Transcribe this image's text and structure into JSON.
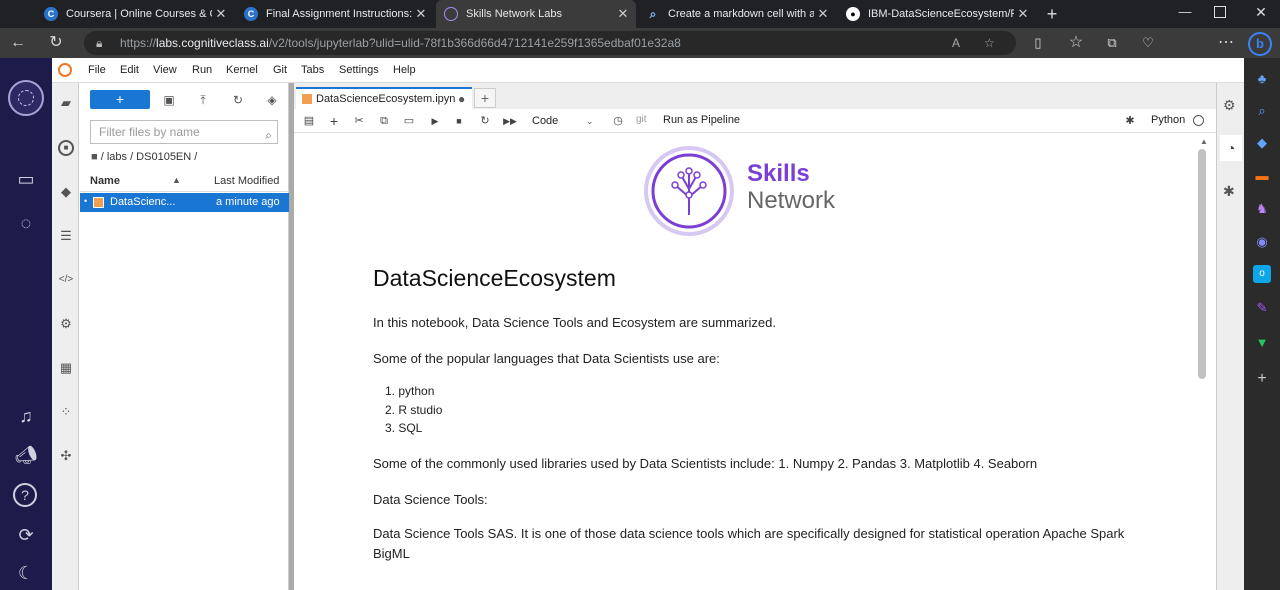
{
  "browser": {
    "tabs": [
      {
        "title": "Coursera | Online Courses & Cre",
        "favicon": "coursera-icon"
      },
      {
        "title": "Final Assignment Instructions: Cr",
        "favicon": "coursera-icon"
      },
      {
        "title": "Skills Network Labs",
        "favicon": "skills-network-icon",
        "active": true
      },
      {
        "title": "Create a markdown cell with a ta",
        "favicon": "search-icon"
      },
      {
        "title": "IBM-DataScienceEcosystem/Peer",
        "favicon": "github-icon"
      }
    ],
    "url_prefix": "https://",
    "url_host": "labs.cognitiveclass.ai",
    "url_rest": "/v2/tools/jupyterlab?ulid=ulid-78f1b366d66d4712141e259f1365edbaf01e32a8"
  },
  "menubar": [
    "File",
    "Edit",
    "View",
    "Run",
    "Kernel",
    "Git",
    "Tabs",
    "Settings",
    "Help"
  ],
  "filebrowser": {
    "new_label": "+",
    "filter_placeholder": "Filter files by name",
    "breadcrumb": "/ labs / DS0105EN /",
    "col_name": "Name",
    "col_modified": "Last Modified",
    "files": [
      {
        "name": "DataScienc...",
        "modified": "a minute ago"
      }
    ]
  },
  "notebook": {
    "tab_title": "DataScienceEcosystem.ipyn",
    "cell_type": "Code",
    "git_label": "git",
    "pipeline_label": "Run as Pipeline",
    "kernel": "Python",
    "logo_word1": "Skills",
    "logo_word2": "Network",
    "heading": "DataScienceEcosystem",
    "intro": "In this notebook, Data Science Tools and Ecosystem are summarized.",
    "languages_intro": "Some of the popular languages that Data Scientists use are:",
    "languages": [
      "python",
      "R studio",
      "SQL"
    ],
    "libraries": "Some of the commonly used libraries used by Data Scientists include: 1. Numpy 2. Pandas 3. Matplotlib 4. Seaborn",
    "tools_title": "Data Science Tools:",
    "tools_text_line1": "Data Science Tools SAS. It is one of those data science tools which are specifically designed for statistical operation Apache Spark",
    "tools_text_line2": "BigML"
  },
  "colors": {
    "brand_purple": "#7b3fd6",
    "jupyter_blue": "#1976d2",
    "left_bar": "#1e1b4b"
  }
}
